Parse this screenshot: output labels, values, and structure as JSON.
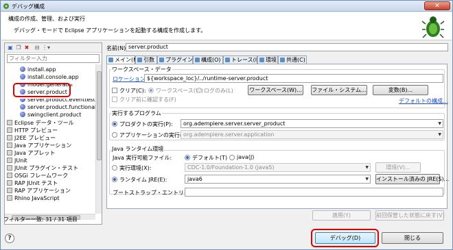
{
  "window": {
    "title": "デバッグ構成",
    "close_label": "✕"
  },
  "header": {
    "title": "構成の作成、管理、および実行",
    "subtitle": "デバッグ・モードで Eclipse アプリケーションを起動する構成を作成します。"
  },
  "left": {
    "filter_placeholder": "フィルター入力",
    "toolbar_icons": [
      "new-config-icon",
      "duplicate-icon",
      "delete-icon",
      "collapse-all-icon",
      "filter-icon"
    ],
    "tree": [
      {
        "label": "install.app",
        "kind": "app",
        "indent": 2
      },
      {
        "label": "install.console.app",
        "kind": "app",
        "indent": 2
      },
      {
        "label": "model.generator",
        "kind": "app",
        "indent": 2
      },
      {
        "label": "server.product",
        "kind": "app",
        "indent": 2,
        "selected": true
      },
      {
        "label": "server.product.eventtest",
        "kind": "app",
        "indent": 2
      },
      {
        "label": "server.product.functionaltest",
        "kind": "app",
        "indent": 2
      },
      {
        "label": "swingclient.product",
        "kind": "app",
        "indent": 2
      },
      {
        "label": "Eclipse データ・ツール",
        "kind": "type",
        "indent": 1
      },
      {
        "label": "HTTP プレビュー",
        "kind": "type",
        "indent": 1
      },
      {
        "label": "J2EE プレビュー",
        "kind": "type",
        "indent": 1
      },
      {
        "label": "Java アプリケーション",
        "kind": "type",
        "indent": 1
      },
      {
        "label": "Java アプレット",
        "kind": "type",
        "indent": 1
      },
      {
        "label": "JUnit",
        "kind": "type",
        "indent": 1
      },
      {
        "label": "JUnit プラグイン・テスト",
        "kind": "type",
        "indent": 1
      },
      {
        "label": "OSGi フレームワーク",
        "kind": "type",
        "indent": 1
      },
      {
        "label": "RAP JUnit テスト",
        "kind": "type",
        "indent": 1
      },
      {
        "label": "RAP アプリケーション",
        "kind": "type",
        "indent": 1
      },
      {
        "label": "Rhino JavaScript",
        "kind": "type",
        "indent": 1
      }
    ],
    "footer": "フィルター一致: 31 / 31 項目"
  },
  "right": {
    "name_label": "名前(N):",
    "name_value": "server.product",
    "tabs": [
      {
        "label": "メイン(M)",
        "active": true
      },
      {
        "label": "引数"
      },
      {
        "label": "プラグイン"
      },
      {
        "label": "構成(O)"
      },
      {
        "label": "トレース(I)"
      },
      {
        "label": "環境"
      },
      {
        "label": "共通(C)"
      }
    ],
    "workspace": {
      "group_label": "ワークスペース・データ",
      "location_label": "ロケーション:",
      "location_value": "${workspace_loc}/../runtime-server.product",
      "clear_label": "クリア(C):",
      "radio_workspace": "ワークスペース(W)",
      "radio_log": "ログのみ(L)",
      "confirm_clear": "クリア前に確認する(F)",
      "btn_workspace": "ワークスペース(W)...",
      "btn_filesystem": "ファイル・システム...",
      "btn_variables": "変数(B)...",
      "default_link": "デフォルトの構成..."
    },
    "program": {
      "group_label": "実行するプログラム",
      "product_label": "プロダクトの実行(P):",
      "product_value": "org.adempiere.server.server_product",
      "app_label": "アプリケーションの実行(A):",
      "app_value": "org.adempiere.server.application"
    },
    "runtime": {
      "group_label": "Java ランタイム環境",
      "exec_env_label": "Java 実行可能ファイル:",
      "radio_default": "デフォルト(T)",
      "radio_java": "java(J)",
      "exec_env_radio_label": "実行環境(X):",
      "exec_env_value": "CDC-1.0/Foundation-1.0 (java5)",
      "env_btn": "環境(V)...",
      "jre_label": "ランタイム JRE(E):",
      "jre_value": "java6",
      "installed_btn": "インストール済みの JRE(S)...",
      "bootstrap_label": "ブートストラップ・エントリー(O):"
    },
    "apply_btn": "適用(Y)",
    "revert_btn": "前回保管した状態に戻す(V)"
  },
  "footer": {
    "debug_btn": "デバッグ(D)",
    "close_btn": "閉じる",
    "help_label": "?"
  }
}
